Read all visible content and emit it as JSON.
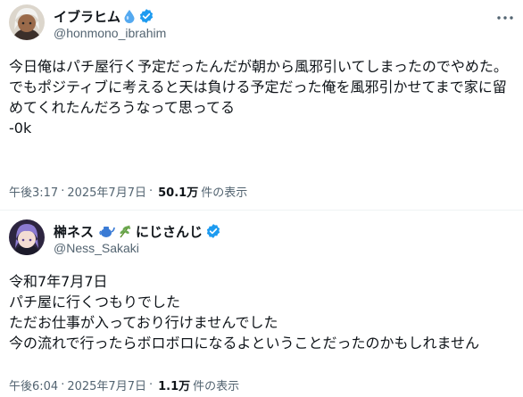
{
  "tweets": [
    {
      "display_name": "イブラヒム",
      "name_emoji": "💧",
      "handle": "@honmono_ibrahim",
      "text": "今日俺はパチ屋行く予定だったんだが朝から風邪引いてしまったのでやめた。\nでもポジティブに考えると天は負ける予定だった俺を風邪引かせてまで家に留めてくれたんだろうなって思ってる\n-0k",
      "time": "午後3:17",
      "date": "2025年7月7日",
      "views_count": "50.1万",
      "views_label": "件の表示"
    },
    {
      "display_name": "榊ネス",
      "name_emoji": "🫖🌿",
      "display_name_suffix": "にじさんじ",
      "handle": "@Ness_Sakaki",
      "text": "令和7年7月7日\nパチ屋に行くつもりでした\nただお仕事が入っており行けませんでした\n今の流れで行ったらボロボロになるよということだったのかもしれません",
      "time": "午後6:04",
      "date": "2025年7月7日",
      "views_count": "1.1万",
      "views_label": "件の表示"
    }
  ],
  "separator": "·",
  "colors": {
    "verified": "#1d9bf0",
    "secondary_text": "#536471",
    "primary_text": "#0f1419",
    "divider": "#eff3f4"
  },
  "icons": {
    "verified": "verified-badge-icon",
    "more": "more-icon"
  }
}
